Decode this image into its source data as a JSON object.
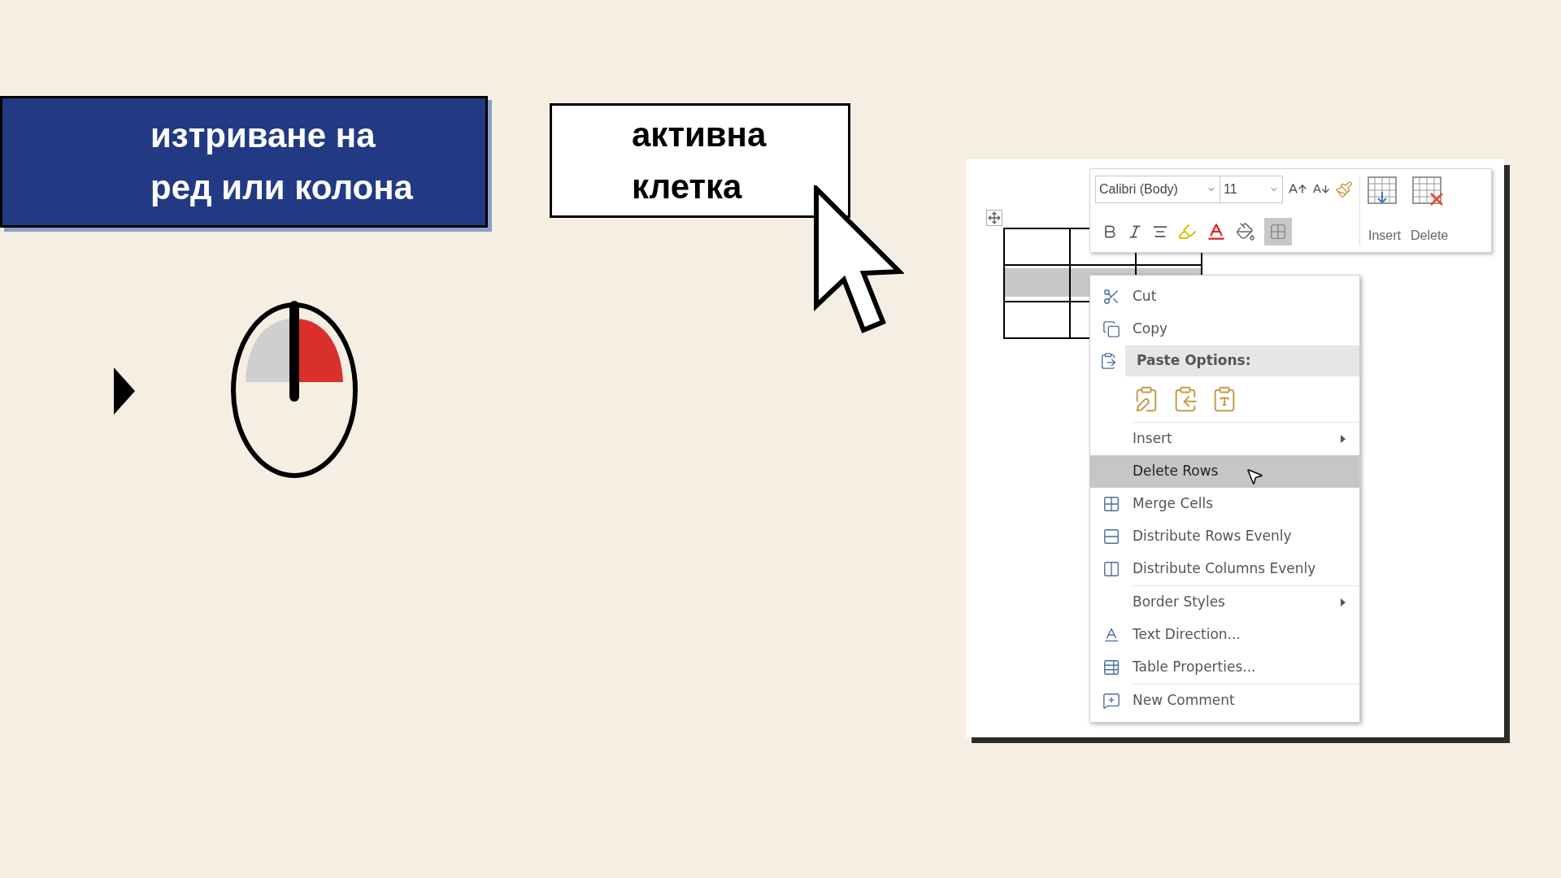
{
  "banner": {
    "lines": [
      "изтриване на",
      "ред или колона"
    ]
  },
  "callout": {
    "lines": [
      "активна",
      "клетка"
    ]
  },
  "mouse": {
    "buttons": [
      {
        "pressed": false
      },
      {
        "pressed": true
      }
    ]
  },
  "document_table": {
    "rows": [
      {
        "selected": false
      },
      {
        "selected": true
      },
      {
        "selected": false
      }
    ]
  },
  "toolbar": {
    "font": "Calibri (Body)",
    "size": "11",
    "borders_pressed": true,
    "actions": [
      "Insert",
      "Delete"
    ]
  },
  "context_menu": {
    "items": [
      {
        "kind": "item",
        "label": "Cut",
        "selected": false
      },
      {
        "kind": "item",
        "label": "Copy",
        "selected": false
      },
      {
        "kind": "header",
        "label": "Paste Options:"
      },
      {
        "kind": "paste"
      },
      {
        "kind": "separator"
      },
      {
        "kind": "submenu",
        "label": "Insert",
        "selected": false
      },
      {
        "kind": "item",
        "label": "Delete Rows",
        "selected": true
      },
      {
        "kind": "item",
        "label": "Merge Cells",
        "selected": false
      },
      {
        "kind": "item",
        "label": "Distribute Rows Evenly",
        "selected": false
      },
      {
        "kind": "item",
        "label": "Distribute Columns Evenly",
        "selected": false
      },
      {
        "kind": "separator"
      },
      {
        "kind": "submenu",
        "label": "Border Styles",
        "selected": false
      },
      {
        "kind": "item",
        "label": "Text Direction...",
        "selected": false
      },
      {
        "kind": "item",
        "label": "Table Properties...",
        "selected": false
      },
      {
        "kind": "separator"
      },
      {
        "kind": "item",
        "label": "New Comment",
        "selected": false
      }
    ]
  }
}
